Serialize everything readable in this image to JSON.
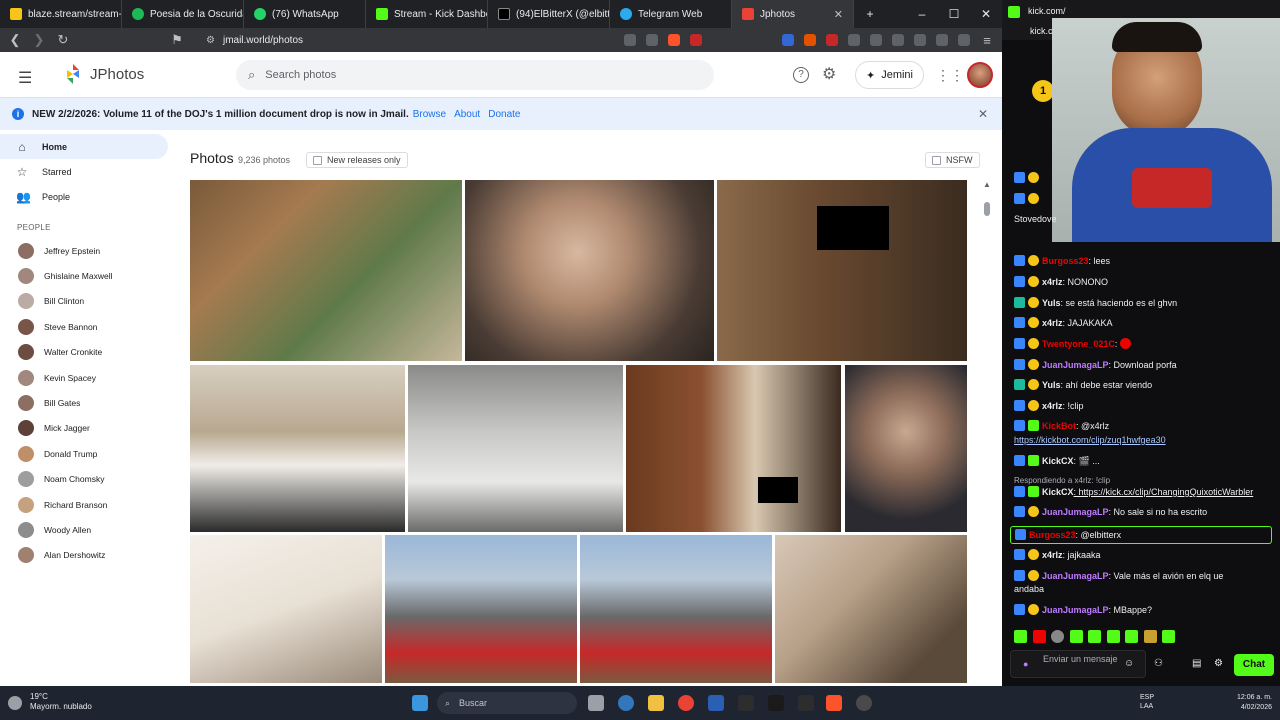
{
  "browser": {
    "tabs": [
      {
        "title": "blaze.stream/stream-sett",
        "color": "#f5c518"
      },
      {
        "title": "Poesia de la Oscurida",
        "color": "#1db954"
      },
      {
        "title": "(76) WhatsApp",
        "color": "#25d366"
      },
      {
        "title": "Stream - Kick Dashboard",
        "color": "#53fc18"
      },
      {
        "title": "(94)ElBitterX (@elbitterx",
        "color": "#000000"
      },
      {
        "title": "Telegram Web",
        "color": "#2aabee"
      },
      {
        "title": "Jphotos",
        "color": "#ea4335"
      }
    ],
    "url": "jmail.world/photos"
  },
  "app": {
    "title": "JPhotos",
    "search_placeholder": "Search photos",
    "help_label": "?",
    "jemini_label": "Jemini"
  },
  "banner": {
    "text": "NEW 2/2/2026: Volume 11 of the DOJ's 1 million document drop is now in Jmail.",
    "browse": "Browse",
    "about": "About",
    "donate": "Donate"
  },
  "sidebar": {
    "nav": [
      {
        "label": "Home",
        "icon": "home-icon"
      },
      {
        "label": "Starred",
        "icon": "star-icon"
      },
      {
        "label": "People",
        "icon": "people-icon"
      }
    ],
    "people_header": "PEOPLE",
    "people": [
      "Jeffrey Epstein",
      "Ghislaine Maxwell",
      "Bill Clinton",
      "Steve Bannon",
      "Walter Cronkite",
      "Kevin Spacey",
      "Bill Gates",
      "Mick Jagger",
      "Donald Trump",
      "Noam Chomsky",
      "Richard Branson",
      "Woody Allen",
      "Alan Dershowitz"
    ]
  },
  "main": {
    "title": "Photos",
    "count": "9,236 photos",
    "new_releases": "New releases only",
    "nsfw": "NSFW"
  },
  "chat": {
    "header_user": "kick.com/",
    "header_domain": "kick.con",
    "stovedove": "Stovedove",
    "messages": [
      {
        "user": "Burgoss23",
        "text": ": lees",
        "color": "c-red"
      },
      {
        "user": "x4rlz",
        "text": ": NONONO",
        "color": "c-white"
      },
      {
        "user": "Yuls",
        "text": ": se está haciendo es el ghvn",
        "color": "c-white"
      },
      {
        "user": "x4rlz",
        "text": ": JAJAKAKA",
        "color": "c-white"
      },
      {
        "user": "Twentyone_021C",
        "text": ":",
        "color": "c-red"
      },
      {
        "user": "JuanJumagaLP",
        "text": ": Download porfa",
        "color": "c-purple"
      },
      {
        "user": "Yuls",
        "text": ": ahí debe estar viendo",
        "color": "c-white"
      },
      {
        "user": "x4rlz",
        "text": ": !clip",
        "color": "c-white"
      },
      {
        "user": "KickBot",
        "text": ": @x4rlz",
        "color": "c-green"
      },
      {
        "user": "",
        "text": "https://kickbot.com/clip/zuq1hwfgea30",
        "color": "c-white"
      },
      {
        "user": "KickCX",
        "text": ": 🎬 ...",
        "color": "c-white"
      },
      {
        "user": "",
        "text": "Respondiendo a x4rlz: !clip",
        "color": "c-white"
      },
      {
        "user": "KickCX",
        "text": ": https://kick.cx/clip/ChangingQuixoticWarbler",
        "color": "c-white"
      },
      {
        "user": "JuanJumagaLP",
        "text": ": No sale si no ha escrito",
        "color": "c-purple"
      },
      {
        "user": "Burgoss23",
        "text": ": @elbitterx",
        "color": "c-red"
      },
      {
        "user": "x4rlz",
        "text": ": jajkaaka",
        "color": "c-white"
      },
      {
        "user": "JuanJumagaLP",
        "text": ": Vale más el avión en elq ue",
        "color": "c-purple"
      },
      {
        "user": "",
        "text": "andaba",
        "color": "c-white"
      },
      {
        "user": "JuanJumagaLP",
        "text": ": MBappe?",
        "color": "c-purple"
      }
    ],
    "input_placeholder": "Enviar un mensaje",
    "send_label": "Chat"
  },
  "taskbar": {
    "weather_temp": "19°C",
    "weather_desc": "Mayorm. nublado",
    "search": "Buscar",
    "lang1": "ESP",
    "lang2": "LAA",
    "time": "12:06 a. m.",
    "date": "4/02/2026"
  }
}
